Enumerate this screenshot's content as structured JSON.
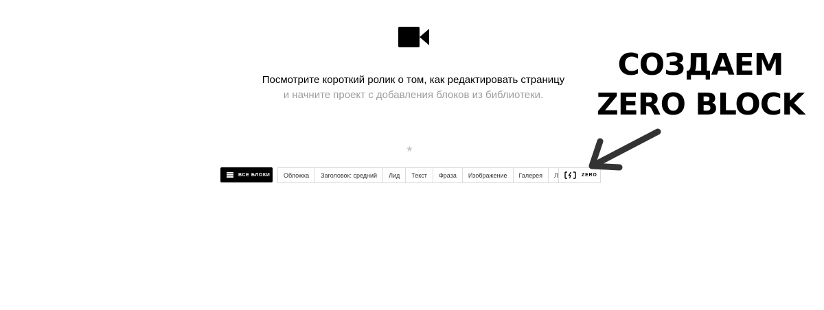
{
  "icons": {
    "video": "video-camera-icon",
    "menu": "menu-lines-icon",
    "zero": "zero-block-icon",
    "star": "star-icon",
    "arrow": "arrow-icon"
  },
  "intro": {
    "line1": "Посмотрите короткий ролик о том, как редактировать страницу",
    "line2": "и начните проект с добавления блоков из библиотеки."
  },
  "star": "★",
  "toolbar": {
    "all_blocks_label": "ВСЕ БЛОКИ",
    "blocks": [
      "Обложка",
      "Заголовок: средний",
      "Лид",
      "Текст",
      "Фраза",
      "Изображение",
      "Галерея",
      "Линия"
    ],
    "zero_label": "ZERO"
  },
  "annotation": {
    "line1": "СОЗДАЕМ",
    "line2": "ZERO BLOCK"
  },
  "colors": {
    "primary_text": "#000000",
    "secondary_text": "#9d9d9d",
    "border": "#dcdcdc",
    "button_dark": "#000000",
    "arrow": "#333333"
  }
}
